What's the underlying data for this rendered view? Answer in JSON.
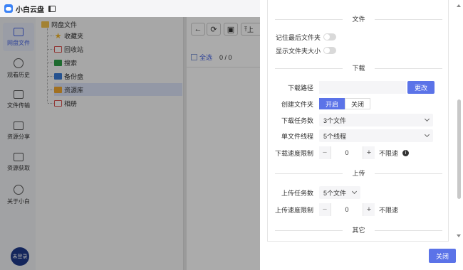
{
  "app": {
    "title": "小白云盘"
  },
  "nav": {
    "items": [
      {
        "label": "网盘文件",
        "icon": "folder-icon"
      },
      {
        "label": "观看历史",
        "icon": "play-icon"
      },
      {
        "label": "文件传输",
        "icon": "transfer-icon"
      },
      {
        "label": "资源分享",
        "icon": "share-icon"
      },
      {
        "label": "资源获取",
        "icon": "download-icon"
      },
      {
        "label": "关于小白",
        "icon": "info-icon"
      }
    ],
    "login": "未登录"
  },
  "tree": {
    "root": "网盘文件",
    "children": [
      "收藏夹",
      "回收站",
      "搜索",
      "备份盘",
      "资源库",
      "相册"
    ],
    "selected": "资源库"
  },
  "files": {
    "upload_label": "上",
    "select_all": "全选",
    "count": "0 / 0"
  },
  "settings": {
    "sections": {
      "file": "文件",
      "download": "下载",
      "upload": "上传",
      "other": "其它"
    },
    "remember_last_folder": "记住最后文件夹",
    "show_folder_size": "显示文件夹大小",
    "download_path_label": "下载路径",
    "download_path_value": "",
    "change_button": "更改",
    "create_folder_label": "创建文件夹",
    "create_folder_on": "开启",
    "create_folder_off": "关闭",
    "download_tasks_label": "下载任务数",
    "download_tasks_value": "3个文件",
    "single_threads_label": "单文件线程",
    "single_threads_value": "5个线程",
    "download_limit_label": "下载速度限制",
    "download_limit_value": "0",
    "download_limit_unit": "不限速",
    "upload_tasks_label": "上传任务数",
    "upload_tasks_value": "5个文件",
    "upload_limit_label": "上传速度限制",
    "upload_limit_value": "0",
    "upload_limit_unit": "不限速",
    "close_button": "关闭"
  },
  "colors": {
    "accent": "#5b73e8"
  }
}
